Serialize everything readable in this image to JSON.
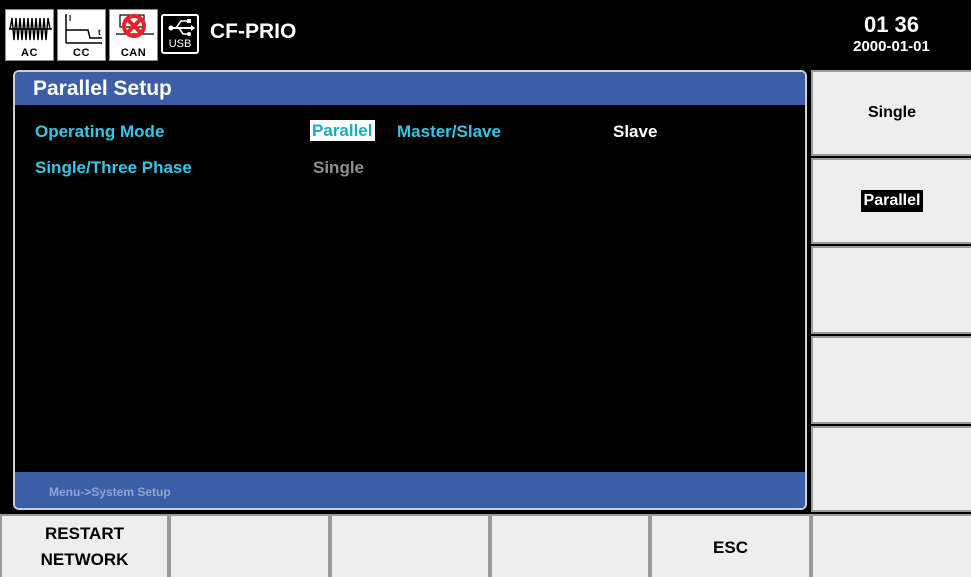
{
  "status_bar": {
    "icons": [
      {
        "name": "ac-waveform-icon",
        "label": "AC"
      },
      {
        "name": "cc-curve-icon",
        "label": "CC"
      },
      {
        "name": "can-error-icon",
        "label": "CAN"
      },
      {
        "name": "usb-icon",
        "label": "USB"
      }
    ],
    "mode_title": "CF-PRIO",
    "time": "01 36",
    "date": "2000-01-01"
  },
  "panel": {
    "title": "Parallel Setup",
    "rows": [
      {
        "label": "Operating Mode",
        "value": "Parallel"
      },
      {
        "label": "Master/Slave",
        "value": "Slave"
      },
      {
        "label": "Single/Three Phase",
        "value": "Single"
      }
    ],
    "breadcrumb": "Menu->System Setup"
  },
  "softkeys": [
    {
      "label": "Single"
    },
    {
      "label": "Parallel"
    },
    {
      "label": ""
    },
    {
      "label": ""
    },
    {
      "label": ""
    }
  ],
  "bottom_keys": [
    {
      "label_line1": "RESTART",
      "label_line2": "NETWORK"
    },
    {
      "label": ""
    },
    {
      "label": ""
    },
    {
      "label": ""
    },
    {
      "label": "ESC"
    },
    {
      "label": ""
    }
  ],
  "colors": {
    "background": "#000000",
    "header_blue": "#3c5ea8",
    "label_cyan": "#35c8e6",
    "key_grey": "#eeeeee",
    "error_red": "#e8222a"
  }
}
